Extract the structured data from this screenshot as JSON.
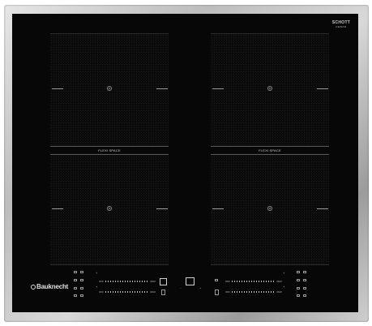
{
  "brand": {
    "name": "Bauknecht"
  },
  "glass_brand": {
    "line1": "SCHOTT",
    "line2": "CERAN"
  },
  "flexi": {
    "left": "FLEXI SPACE",
    "right": "FLEXI SPACE"
  },
  "sliders": {
    "off_label": "OFF",
    "max_label": "MAX"
  },
  "controls": {
    "plus": "+",
    "minus": "–"
  },
  "colors": {
    "glass": "#070707",
    "frame": "#c4c4c4",
    "print": "#bdbdbd"
  }
}
